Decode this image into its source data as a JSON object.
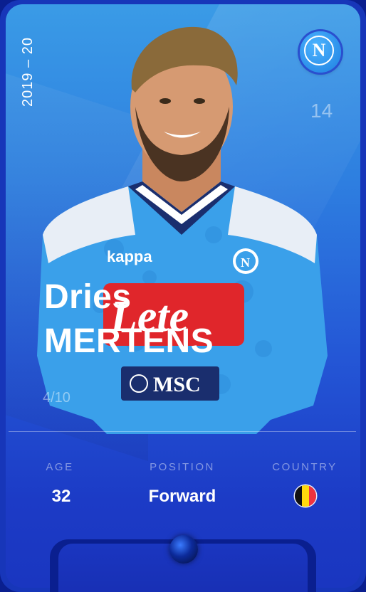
{
  "card": {
    "season": "2019 – 20",
    "club_icon": "ssc-napoli-crest-icon",
    "club_letter": "N",
    "jersey_number": "14",
    "player": {
      "first_name": "Dries",
      "last_name": "MERTENS"
    },
    "serial": "4/10",
    "stats": {
      "age_label": "AGE",
      "age_value": "32",
      "position_label": "POSITION",
      "position_value": "Forward",
      "country_label": "COUNTRY",
      "country_flag_icon": "belgium-flag-icon"
    },
    "rarity_icon": "rare-gem-icon"
  },
  "colors": {
    "card_top": "#3a9be6",
    "card_bottom": "#1a36c0",
    "frame": "#0a1f8f",
    "flag_black": "#111111",
    "flag_yellow": "#ffd90c",
    "flag_red": "#ef3340",
    "shirt_blue": "#3aa0ea",
    "sponsor_red": "#e0262b"
  }
}
